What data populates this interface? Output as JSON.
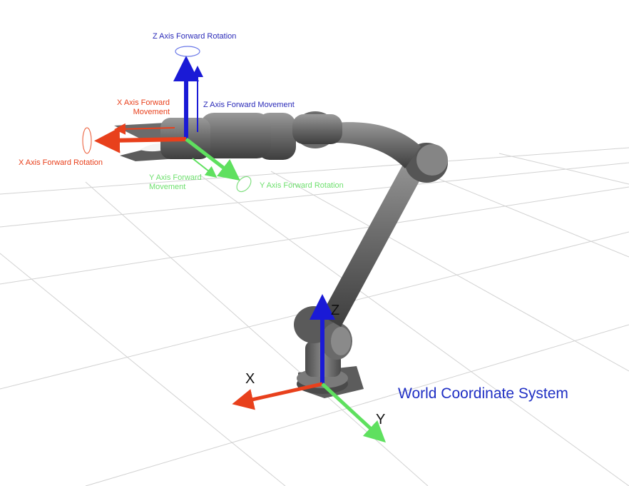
{
  "labels": {
    "z_rotation": "Z Axis Forward Rotation",
    "z_movement": "Z Axis Forward Movement",
    "x_movement_line1": "X Axis Forward",
    "x_movement_line2": "Movement",
    "x_rotation": "X Axis Forward Rotation",
    "y_movement_line1": "Y Axis Forward",
    "y_movement_line2": "Movement",
    "y_rotation": "Y Axis Forward Rotation"
  },
  "world": {
    "x_label": "X",
    "y_label": "Y",
    "z_label": "Z",
    "title": "World Coordinate System"
  },
  "colors": {
    "x_axis": "#e8401c",
    "y_axis": "#5fe05f",
    "z_axis": "#1a1ad6",
    "robot": "#6e6e6e",
    "grid": "#d0d0d0"
  }
}
